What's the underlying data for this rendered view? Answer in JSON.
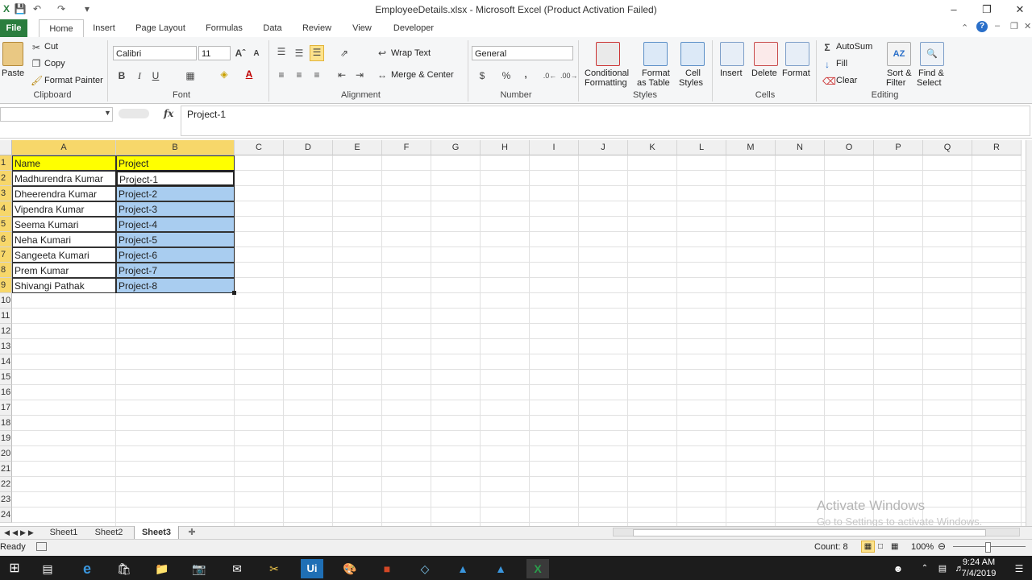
{
  "window": {
    "title": "EmployeeDetails.xlsx - Microsoft Excel (Product Activation Failed)"
  },
  "tabs": [
    "File",
    "Home",
    "Insert",
    "Page Layout",
    "Formulas",
    "Data",
    "Review",
    "View",
    "Developer"
  ],
  "ribbon": {
    "clipboard": {
      "paste": "Paste",
      "cut": "Cut",
      "copy": "Copy",
      "format_painter": "Format Painter",
      "label": "Clipboard"
    },
    "font": {
      "name": "Calibri",
      "size": "11",
      "label": "Font"
    },
    "alignment": {
      "wrap_text": "Wrap Text",
      "merge_center": "Merge & Center",
      "label": "Alignment"
    },
    "number": {
      "format": "General",
      "label": "Number"
    },
    "styles": {
      "conditional": "Conditional",
      "conditional2": "Formatting",
      "format_table": "Format",
      "format_table2": "as Table",
      "cell_styles": "Cell",
      "cell_styles2": "Styles",
      "label": "Styles"
    },
    "cells": {
      "insert": "Insert",
      "delete": "Delete",
      "format": "Format",
      "label": "Cells"
    },
    "editing": {
      "autosum": "AutoSum",
      "fill": "Fill",
      "clear": "Clear",
      "sort": "Sort &",
      "sort2": "Filter",
      "find": "Find &",
      "find2": "Select",
      "label": "Editing"
    }
  },
  "formula_bar": {
    "fx": "fx",
    "content": "Project-1"
  },
  "columns": [
    "A",
    "B",
    "C",
    "D",
    "E",
    "F",
    "G",
    "H",
    "I",
    "J",
    "K",
    "L",
    "M",
    "N",
    "O",
    "P",
    "Q",
    "R"
  ],
  "rows": [
    "1",
    "2",
    "3",
    "4",
    "5",
    "6",
    "7",
    "8",
    "9",
    "10",
    "11",
    "12",
    "13",
    "14",
    "15",
    "16",
    "17",
    "18",
    "19",
    "20",
    "21",
    "22",
    "23",
    "24"
  ],
  "table": {
    "headers": [
      "Name",
      "Project"
    ],
    "rows": [
      [
        "Madhurendra Kumar",
        "Project-1"
      ],
      [
        "Dheerendra Kumar",
        "Project-2"
      ],
      [
        "Vipendra Kumar",
        "Project-3"
      ],
      [
        "Seema Kumari",
        "Project-4"
      ],
      [
        "Neha Kumari",
        "Project-5"
      ],
      [
        "Sangeeta Kumari",
        "Project-6"
      ],
      [
        "Prem Kumar",
        "Project-7"
      ],
      [
        "Shivangi Pathak",
        "Project-8"
      ]
    ]
  },
  "sheets": [
    "Sheet1",
    "Sheet2",
    "Sheet3"
  ],
  "active_sheet": "Sheet3",
  "status": {
    "ready": "Ready",
    "count": "Count: 8",
    "zoom": "100%"
  },
  "watermark": {
    "line1": "Activate Windows",
    "line2": "Go to Settings to activate Windows."
  },
  "clock": {
    "time": "9:24 AM",
    "date": "7/4/2019"
  },
  "colors": {
    "accent": "#2a7d3e",
    "header_fill": "#ffff00",
    "selection": "#a9cdf0",
    "selected_header": "#f7d76a"
  }
}
